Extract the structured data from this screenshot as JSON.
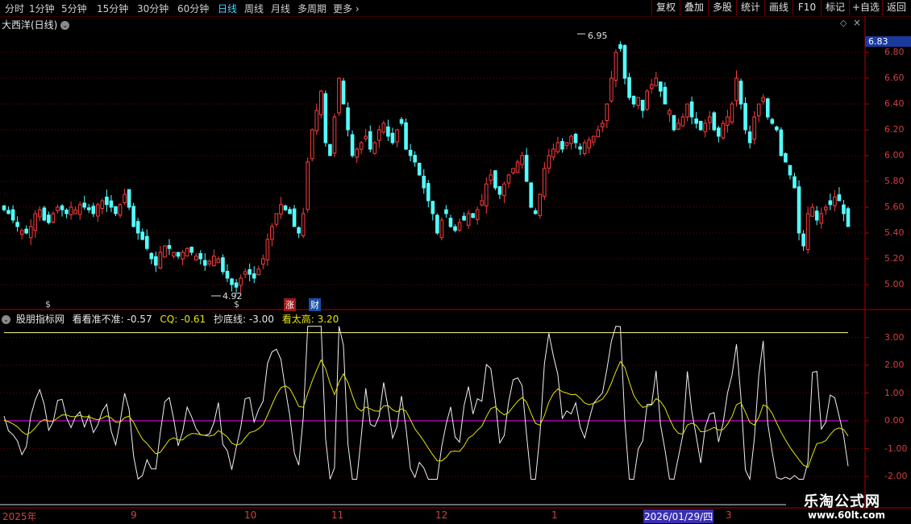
{
  "toolbar": {
    "periods": [
      "分时",
      "1分钟",
      "5分钟",
      "15分钟",
      "30分钟",
      "60分钟",
      "日线",
      "周线",
      "月线",
      "多周期",
      "更多"
    ],
    "active_period": "日线",
    "buttons": [
      "复权",
      "叠加",
      "多股",
      "统计",
      "画线",
      "F10",
      "标记",
      "+自选",
      "返回"
    ]
  },
  "stock": {
    "title": "大西洋(日线)"
  },
  "price_axis": {
    "ticks": [
      "6.80",
      "6.60",
      "6.40",
      "6.20",
      "6.00",
      "5.80",
      "5.60",
      "5.40",
      "5.20",
      "5.00"
    ],
    "current_price": "6.83",
    "high_marker": "6.95",
    "low_marker": "4.92"
  },
  "event_tags": [
    {
      "text": "$",
      "color": "#ff3030"
    },
    {
      "text": "$",
      "color": "#ff3030"
    },
    {
      "text": "涨",
      "color": "#ffffff",
      "bg": "#a01818"
    },
    {
      "text": "财",
      "color": "#ffffff",
      "bg": "#1a4fa8"
    }
  ],
  "indicator": {
    "name": "股朋指标网",
    "items": [
      {
        "label": "看看准不准: -0.57",
        "color": "#e8e8e8"
      },
      {
        "label": "CQ: -0.61",
        "color": "#e6e600"
      },
      {
        "label": "抄底线: -3.00",
        "color": "#e8e8e8"
      },
      {
        "label": "看太高: 3.20",
        "color": "#e6e600"
      }
    ],
    "ticks": [
      "3.00",
      "2.00",
      "1.00",
      "0.00",
      "-1.00",
      "-2.00"
    ]
  },
  "date_axis": {
    "labels": [
      "2025年",
      "9",
      "10",
      "11",
      "12",
      "1",
      "2026/01/29/四",
      "3"
    ],
    "selected": "2026/01/29/四"
  },
  "watermark": {
    "line1": "乐淘公式网",
    "line2": "www.60lt.com"
  },
  "colors": {
    "up": "#ff3c3c",
    "down": "#54ffff",
    "grid": "#7a0000",
    "cq": "#e6e600",
    "zero": "#ff00ff",
    "high_line": "#ffff80"
  },
  "chart_data": [
    {
      "type": "candlestick",
      "title": "大西洋(日线)",
      "ylim": [
        4.9,
        6.95
      ],
      "high": 6.95,
      "low": 4.92,
      "last": 6.83,
      "closes": [
        5.58,
        5.55,
        5.5,
        5.45,
        5.42,
        5.4,
        5.45,
        5.55,
        5.58,
        5.5,
        5.48,
        5.55,
        5.6,
        5.58,
        5.55,
        5.6,
        5.58,
        5.62,
        5.6,
        5.58,
        5.55,
        5.62,
        5.65,
        5.62,
        5.6,
        5.55,
        5.62,
        5.7,
        5.6,
        5.45,
        5.4,
        5.35,
        5.28,
        5.2,
        5.15,
        5.25,
        5.3,
        5.28,
        5.25,
        5.22,
        5.25,
        5.28,
        5.25,
        5.22,
        5.2,
        5.15,
        5.18,
        5.22,
        5.2,
        5.1,
        5.05,
        5.0,
        4.98,
        5.05,
        5.1,
        5.08,
        5.05,
        5.12,
        5.2,
        5.35,
        5.45,
        5.55,
        5.62,
        5.58,
        5.55,
        5.45,
        5.4,
        5.55,
        5.95,
        6.2,
        6.35,
        6.5,
        6.1,
        6.0,
        6.3,
        6.6,
        6.4,
        6.2,
        6.0,
        6.05,
        6.1,
        6.15,
        6.05,
        6.1,
        6.2,
        6.25,
        6.15,
        6.1,
        6.2,
        6.25,
        6.05,
        6.0,
        5.95,
        5.85,
        5.75,
        5.65,
        5.55,
        5.4,
        5.5,
        5.55,
        5.45,
        5.42,
        5.48,
        5.5,
        5.55,
        5.52,
        5.58,
        5.65,
        5.78,
        5.85,
        5.75,
        5.7,
        5.78,
        5.85,
        5.9,
        5.95,
        6.0,
        5.8,
        5.6,
        5.55,
        5.7,
        5.9,
        6.0,
        6.05,
        6.1,
        6.05,
        6.1,
        6.15,
        6.1,
        6.05,
        6.1,
        6.12,
        6.15,
        6.2,
        6.25,
        6.4,
        6.6,
        6.8,
        6.83,
        6.6,
        6.45,
        6.4,
        6.45,
        6.35,
        6.5,
        6.55,
        6.6,
        6.5,
        6.4,
        6.35,
        6.2,
        6.25,
        6.3,
        6.4,
        6.3,
        6.25,
        6.2,
        6.25,
        6.3,
        6.2,
        6.15,
        6.25,
        6.3,
        6.4,
        6.6,
        6.4,
        6.2,
        6.1,
        6.3,
        6.4,
        6.45,
        6.3,
        6.25,
        6.2,
        6.0,
        5.95,
        5.85,
        5.75,
        5.4,
        5.3,
        5.55,
        5.6,
        5.5,
        5.55,
        5.6,
        5.62,
        5.68,
        5.65,
        5.55,
        5.45
      ]
    },
    {
      "type": "line",
      "series": [
        {
          "name": "看看准不准",
          "last": -0.57
        },
        {
          "name": "CQ",
          "last": -0.61
        },
        {
          "name": "抄底线",
          "value": -3.0
        },
        {
          "name": "看太高",
          "value": 3.2
        }
      ],
      "ylim": [
        -2.1,
        3.5
      ]
    }
  ]
}
